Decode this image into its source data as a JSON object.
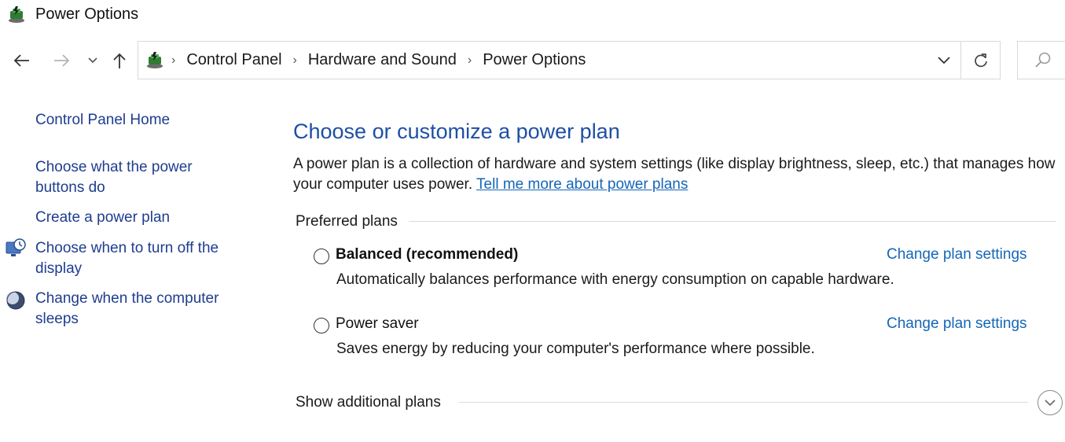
{
  "window": {
    "title": "Power Options"
  },
  "address_bar": {
    "breadcrumbs": [
      "Control Panel",
      "Hardware and Sound",
      "Power Options"
    ]
  },
  "left_pane": {
    "home": "Control Panel Home",
    "links": {
      "power_buttons": "Choose what the power buttons do",
      "create_plan": "Create a power plan",
      "turn_off_display": "Choose when to turn off the display",
      "computer_sleeps": "Change when the computer sleeps"
    }
  },
  "main": {
    "heading": "Choose or customize a power plan",
    "intro_text": "A power plan is a collection of hardware and system settings (like display brightness, sleep, etc.) that manages how your computer uses power. ",
    "intro_link": "Tell me more about power plans",
    "preferred_label": "Preferred plans",
    "plans": [
      {
        "name": "Balanced (recommended)",
        "description": "Automatically balances performance with energy consumption on capable hardware.",
        "link": "Change plan settings",
        "selected": false
      },
      {
        "name": "Power saver",
        "description": "Saves energy by reducing your computer's performance where possible.",
        "link": "Change plan settings",
        "selected": false
      }
    ],
    "additional_label": "Show additional plans"
  },
  "colors": {
    "heading": "#1e4fa3",
    "link": "#1466b8",
    "nav_link": "#1f3d8f",
    "border": "#d9d9d9"
  },
  "icons": {
    "app": "power-options-icon",
    "back": "back-arrow-icon",
    "forward": "forward-arrow-icon",
    "recent": "chevron-down-icon",
    "up": "up-arrow-icon",
    "refresh": "refresh-icon",
    "search": "search-icon",
    "display": "display-clock-icon",
    "sleep": "moon-icon",
    "expand": "chevron-down-icon"
  }
}
